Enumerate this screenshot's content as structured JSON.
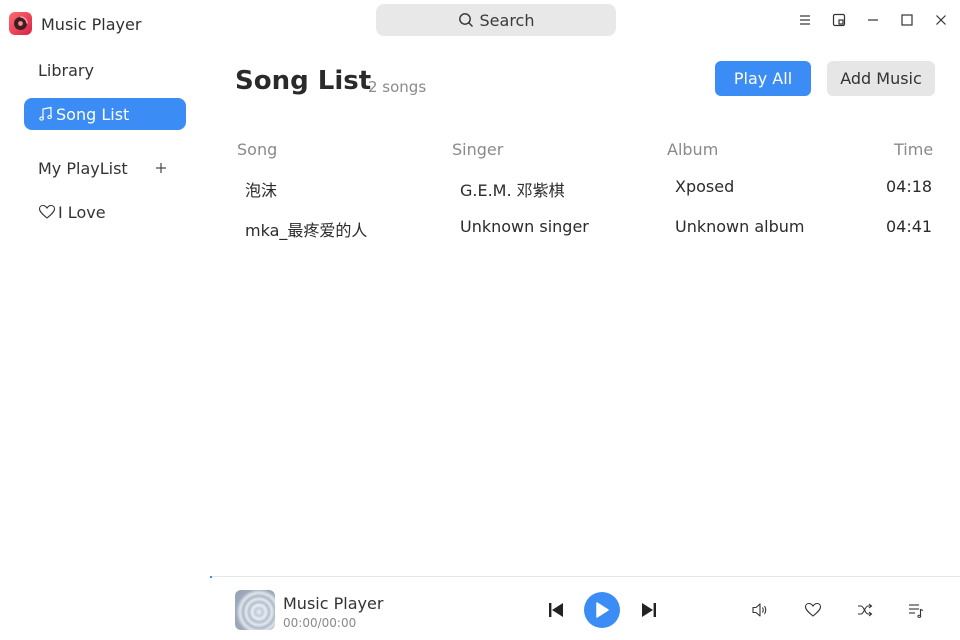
{
  "app": {
    "title": "Music Player"
  },
  "search": {
    "label": "Search"
  },
  "sidebar": {
    "library_label": "Library",
    "song_list_label": "Song List",
    "my_playlist_label": "My PlayList",
    "i_love_label": "I Love"
  },
  "main": {
    "title": "Song List",
    "count": "2 songs",
    "play_all_label": "Play All",
    "add_music_label": "Add Music",
    "columns": {
      "song": "Song",
      "singer": "Singer",
      "album": "Album",
      "time": "Time"
    },
    "rows": [
      {
        "song": "泡沫",
        "singer": "G.E.M. 邓紫棋",
        "album": "Xposed",
        "time": "04:18"
      },
      {
        "song": "mka_最疼爱的人",
        "singer": "Unknown singer",
        "album": "Unknown album",
        "time": "04:41"
      }
    ]
  },
  "player": {
    "title": "Music Player",
    "time": "00:00/00:00",
    "progress": 0
  },
  "colors": {
    "accent": "#3b8cf5",
    "secondary_button": "#e6e6e6",
    "search_bg": "#e8e8e8"
  }
}
